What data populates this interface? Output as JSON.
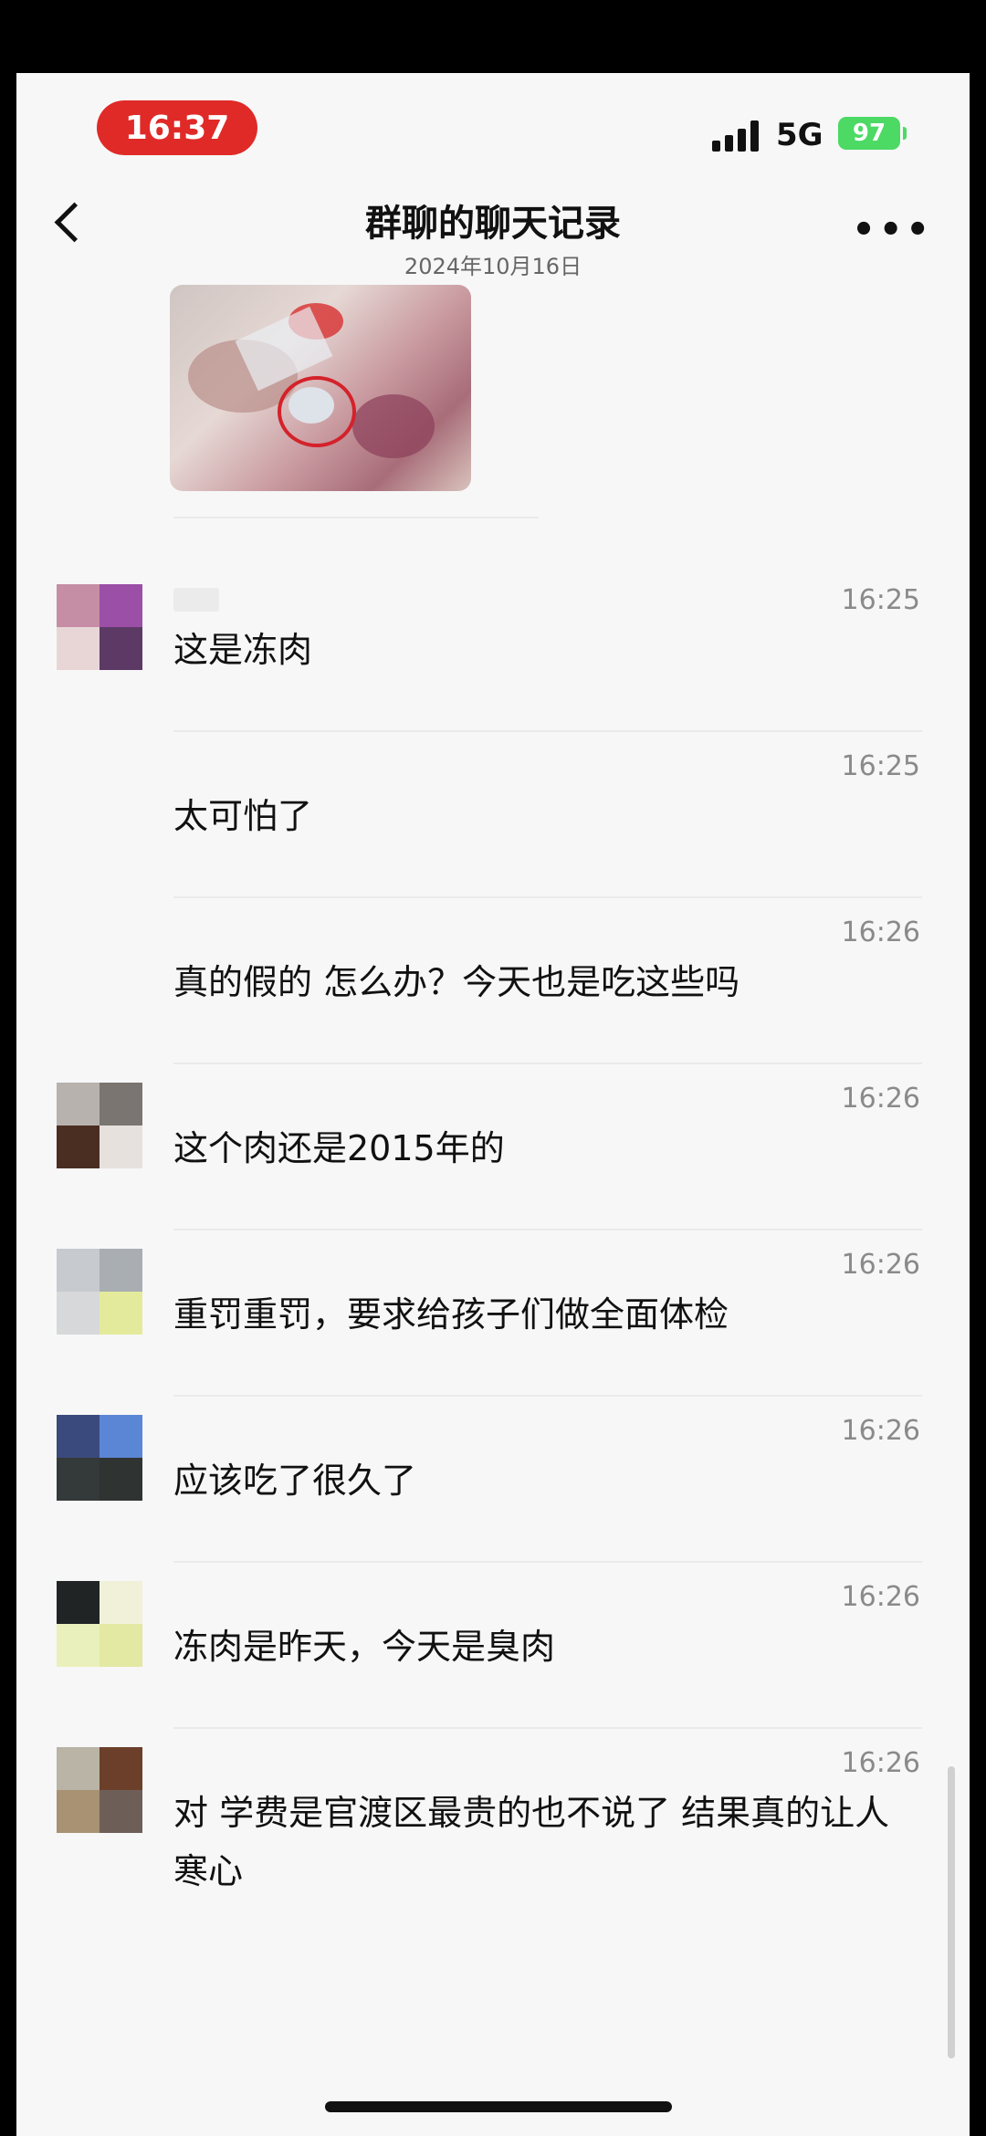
{
  "status_bar": {
    "time": "16:37",
    "network": "5G",
    "battery": "97",
    "signal_icon": "signal-bars-icon",
    "battery_color": "#4cd964",
    "time_pill_color": "#e02a27"
  },
  "header": {
    "title": "群聊的聊天记录",
    "subtitle": "2024年10月16日",
    "back_icon": "chevron-left-icon",
    "more_icon": "more-horizontal-icon",
    "more_label": "•••"
  },
  "messages": [
    {
      "time": "16:25",
      "text": "这是冻肉",
      "avatar_colors": [
        "#c58ea5",
        "#9b4fa6",
        "#e8d6d7",
        "#5d3a66"
      ]
    },
    {
      "time": "16:25",
      "text": "太可怕了",
      "avatar_colors": []
    },
    {
      "time": "16:26",
      "text": "真的假的  怎么办？今天也是吃这些吗",
      "avatar_colors": []
    },
    {
      "time": "16:26",
      "text": "这个肉还是2015年的",
      "avatar_colors": [
        "#b7b2ad",
        "#7a7570",
        "#4a2e22",
        "#e6e1dd"
      ]
    },
    {
      "time": "16:26",
      "text": "重罚重罚，要求给孩子们做全面体检",
      "avatar_colors": [
        "#c7cbcf",
        "#a9aeb2",
        "#d6d8d9",
        "#e4ea9b"
      ]
    },
    {
      "time": "16:26",
      "text": "应该吃了很久了",
      "avatar_colors": [
        "#3b4a7c",
        "#5b86d6",
        "#34393a",
        "#2f3331"
      ]
    },
    {
      "time": "16:26",
      "text": "冻肉是昨天，今天是臭肉",
      "avatar_colors": [
        "#202425",
        "#f0f1d8",
        "#eaf0bb",
        "#e3e8a3"
      ]
    },
    {
      "time": "16:26",
      "text": "对  学费是官渡区最贵的也不说了  结果真的让人寒心",
      "avatar_colors": [
        "#b9b4a6",
        "#6b3f2a",
        "#a89273",
        "#6d5f58"
      ]
    }
  ]
}
